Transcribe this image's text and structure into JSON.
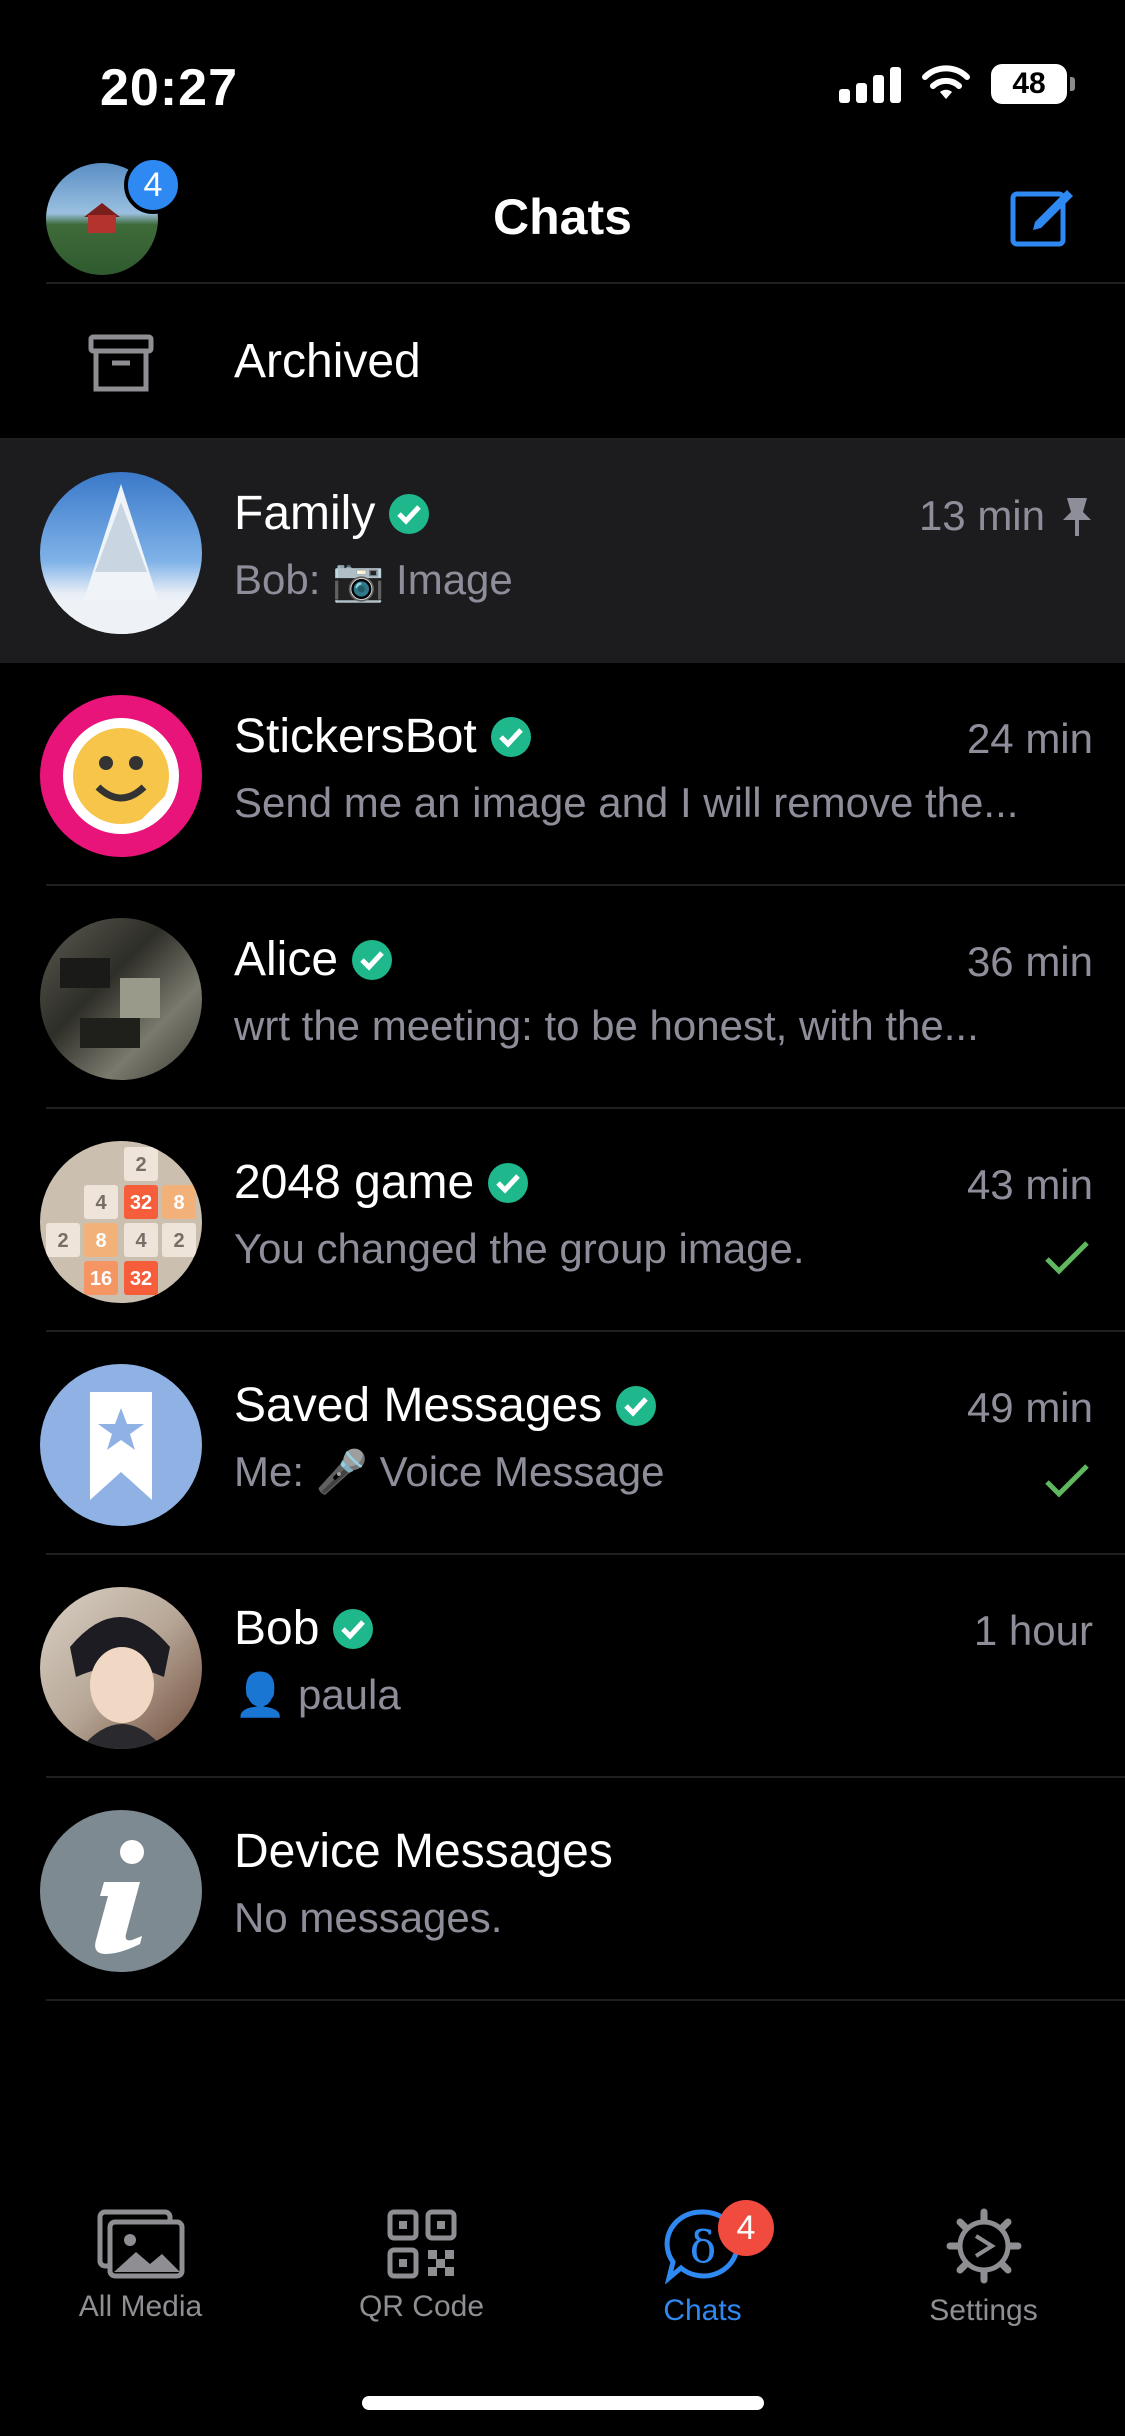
{
  "status": {
    "time": "20:27",
    "battery": "48"
  },
  "header": {
    "title": "Chats",
    "profile_badge": "4"
  },
  "archived": {
    "label": "Archived"
  },
  "chats": [
    {
      "name": "Family",
      "time": "13 min",
      "preview": "Bob: 📷 Image"
    },
    {
      "name": "StickersBot",
      "time": "24 min",
      "preview": "Send me an image and I will remove the..."
    },
    {
      "name": "Alice",
      "time": "36 min",
      "preview": "wrt the meeting: to be honest, with the..."
    },
    {
      "name": "2048 game",
      "time": "43 min",
      "preview": "You changed the group image."
    },
    {
      "name": "Saved Messages",
      "time": "49 min",
      "preview": "Me: 🎤 Voice Message"
    },
    {
      "name": "Bob",
      "time": "1 hour",
      "preview": "👤 paula"
    },
    {
      "name": "Device Messages",
      "time": "",
      "preview": "No messages."
    }
  ],
  "game_tiles": [
    "2",
    "4",
    "32",
    "8",
    "2",
    "8",
    "4",
    "2",
    "16",
    "32"
  ],
  "tabs": [
    {
      "label": "All Media"
    },
    {
      "label": "QR Code"
    },
    {
      "label": "Chats",
      "badge": "4"
    },
    {
      "label": "Settings"
    }
  ],
  "colors": {
    "accent": "#2f89f2",
    "verified": "#1fb78c",
    "badge": "#f04b3e",
    "muted": "#8e8e9a",
    "check": "#5fb85f"
  }
}
